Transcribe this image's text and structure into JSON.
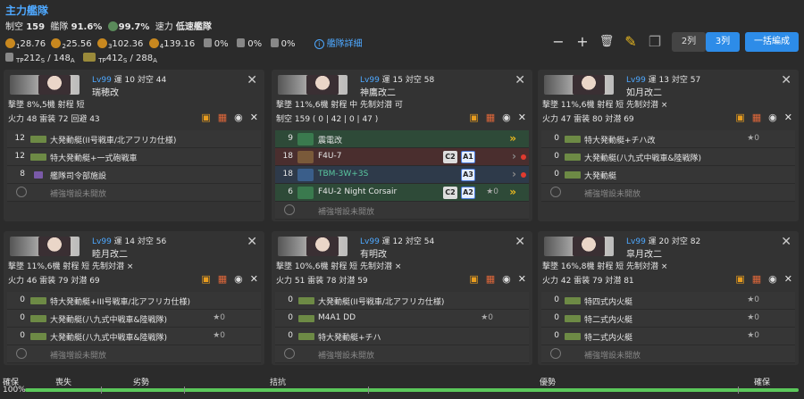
{
  "header": {
    "title": "主力艦隊",
    "seiku_label": "制空",
    "seiku": "159",
    "kanpi_label": "艦隊",
    "kanpi": "91.6%",
    "los_val": "99.7%",
    "speed_label": "速力",
    "speed": "低速艦隊",
    "los": [
      {
        "n": "1",
        "v": "28.76"
      },
      {
        "n": "2",
        "v": "25.56"
      },
      {
        "n": "3",
        "v": "102.36"
      },
      {
        "n": "4",
        "v": "139.16"
      }
    ],
    "pct": [
      "0%",
      "0%",
      "0%"
    ],
    "detail": "艦隊詳細",
    "supply": {
      "tp_s": "212",
      "tp_s_sub": "S",
      "slash1": "/ 148",
      "a1": "A",
      "tp2": "412",
      "tp2_sub": "S",
      "slash2": "/ 288",
      "a2": "A",
      "tp_lbl": "TP"
    }
  },
  "toolbar": {
    "minus": "−",
    "plus": "+",
    "trash": "🗑",
    "col2": "2列",
    "col3": "3列",
    "form": "一括編成"
  },
  "ships": [
    {
      "lv": "Lv99",
      "luck": "運 10",
      "aa": "対空 44",
      "name": "瑞穂改",
      "l3": "撃墜 8%,5機 射程 短",
      "l4": "火力 48 雷装 72 回避 43",
      "slots": [
        {
          "c": "12",
          "n": "大発動艇(II号戦車/北アフリカ仕様)"
        },
        {
          "c": "12",
          "n": "特大発動艇+一式砲戦車"
        },
        {
          "c": "8",
          "n": "艦隊司令部施設"
        }
      ],
      "ex": "補強増設未開放"
    },
    {
      "lv": "Lv99",
      "luck": "運 15",
      "aa": "対空 58",
      "name": "神鷹改二",
      "l3": "撃墜 11%,6機 射程 中 先制対潜 可",
      "l4": "制空 159 ( 0 | 42 | 0 | 47 )",
      "slots": [
        {
          "c": "9",
          "n": "震電改"
        },
        {
          "c": "18",
          "n": "F4U-7",
          "tc": "C2",
          "ta": "A1"
        },
        {
          "c": "18",
          "n": "TBM-3W+3S",
          "ta": "A3"
        },
        {
          "c": "6",
          "n": "F4U-2 Night Corsair",
          "tc": "C2",
          "ta": "A2",
          "s": "★0"
        }
      ],
      "ex": "補強増設未開放"
    },
    {
      "lv": "Lv99",
      "luck": "運 13",
      "aa": "対空 57",
      "name": "如月改二",
      "l3": "撃墜 11%,6機 射程 短 先制対潜 ×",
      "l4": "火力 47 雷装 80 対潜 69",
      "slots": [
        {
          "c": "0",
          "n": "特大発動艇+チハ改",
          "s": "★0"
        },
        {
          "c": "0",
          "n": "大発動艇(八九式中戦車&陸戦隊)"
        },
        {
          "c": "0",
          "n": "大発動艇"
        }
      ],
      "ex": "補強増設未開放"
    },
    {
      "lv": "Lv99",
      "luck": "運 14",
      "aa": "対空 56",
      "name": "睦月改二",
      "l3": "撃墜 11%,6機 射程 短 先制対潜 ×",
      "l4": "火力 46 雷装 79 対潜 69",
      "slots": [
        {
          "c": "0",
          "n": "特大発動艇+III号戦車/北アフリカ仕様)"
        },
        {
          "c": "0",
          "n": "大発動艇(八九式中戦車&陸戦隊)",
          "s": "★0"
        },
        {
          "c": "0",
          "n": "大発動艇(八九式中戦車&陸戦隊)",
          "s": "★0"
        }
      ],
      "ex": "補強増設未開放"
    },
    {
      "lv": "Lv99",
      "luck": "運 12",
      "aa": "対空 54",
      "name": "有明改",
      "l3": "撃墜 10%,6機 射程 短 先制対潜 ×",
      "l4": "火力 51 雷装 78 対潜 59",
      "slots": [
        {
          "c": "0",
          "n": "大発動艇(II号戦車/北アフリカ仕様)"
        },
        {
          "c": "0",
          "n": "M4A1 DD",
          "s": "★0"
        },
        {
          "c": "0",
          "n": "特大発動艇+チハ"
        }
      ],
      "ex": "補強増設未開放"
    },
    {
      "lv": "Lv99",
      "luck": "運 20",
      "aa": "対空 82",
      "name": "皐月改二",
      "l3": "撃墜 16%,8機 射程 短 先制対潜 ×",
      "l4": "火力 42 雷装 79 対潜 81",
      "slots": [
        {
          "c": "0",
          "n": "特四式内火艇",
          "s": "★0"
        },
        {
          "c": "0",
          "n": "特二式内火艇",
          "s": "★0"
        },
        {
          "c": "0",
          "n": "特二式内火艇",
          "s": "★0"
        }
      ],
      "ex": "補強増設未開放"
    }
  ],
  "air": {
    "labels": [
      "確保",
      "喪失",
      "劣勢",
      "拮抗",
      "優勢",
      "確保"
    ],
    "pct": "100%",
    "fill": 1.0
  }
}
